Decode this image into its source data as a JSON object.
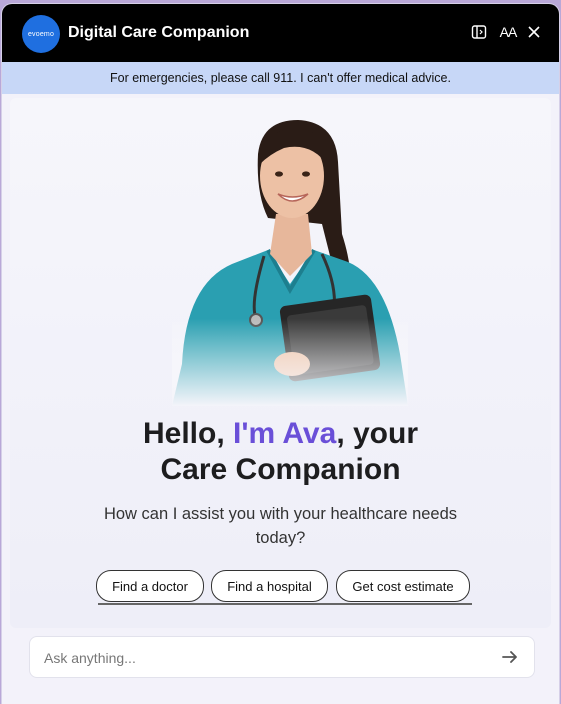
{
  "header": {
    "logo_text": "evoemo",
    "title": "Digital Care Companion",
    "icons": [
      "sidebar-panel-icon",
      "text-size-icon",
      "close-icon"
    ],
    "text_size_label": "AA"
  },
  "banner": {
    "text": "For emergencies, please call 911. I can't offer medical advice."
  },
  "hero": {
    "greeting_prefix": "Hello, ",
    "greeting_name": "I'm Ava",
    "greeting_suffix": ", your",
    "greeting_line2": "Care Companion",
    "subtitle": "How can I assist you with your healthcare needs today?"
  },
  "suggestions": [
    {
      "label": "Find a doctor"
    },
    {
      "label": "Find a hospital"
    },
    {
      "label": "Get cost estimate"
    }
  ],
  "composer": {
    "placeholder": "Ask anything...",
    "value": ""
  },
  "colors": {
    "accent": "#6a4fd8",
    "titlebar": "#000000",
    "banner": "#c7d7f7",
    "logo": "#1f6fe0"
  }
}
